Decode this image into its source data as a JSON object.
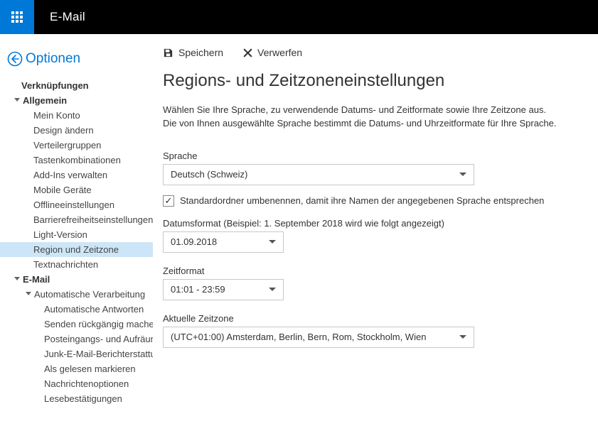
{
  "header": {
    "app_title": "E-Mail"
  },
  "sidebar": {
    "back_label": "Optionen",
    "shortcuts_label": "Verknüpfungen",
    "groups": [
      {
        "label": "Allgemein",
        "items": [
          "Mein Konto",
          "Design ändern",
          "Verteilergruppen",
          "Tastenkombinationen",
          "Add-Ins verwalten",
          "Mobile Geräte",
          "Offlineeinstellungen",
          "Barrierefreiheitseinstellungen",
          "Light-Version",
          "Region und Zeitzone",
          "Textnachrichten"
        ]
      },
      {
        "label": "E-Mail",
        "subgroups": [
          {
            "label": "Automatische Verarbeitung",
            "items": [
              "Automatische Antworten",
              "Senden rückgängig machen",
              "Posteingangs- und Aufräumregeln",
              "Junk-E-Mail-Berichterstattung",
              "Als gelesen markieren",
              "Nachrichtenoptionen",
              "Lesebestätigungen"
            ]
          }
        ]
      }
    ]
  },
  "commands": {
    "save": "Speichern",
    "discard": "Verwerfen"
  },
  "page": {
    "title": "Regions- und Zeitzoneneinstellungen",
    "desc1": "Wählen Sie Ihre Sprache, zu verwendende Datums- und Zeitformate sowie Ihre Zeitzone aus.",
    "desc2": "Die von Ihnen ausgewählte Sprache bestimmt die Datums- und Uhrzeitformate für Ihre Sprache.",
    "language_label": "Sprache",
    "language_value": "Deutsch (Schweiz)",
    "rename_checkbox": "Standardordner umbenennen, damit ihre Namen der angegebenen Sprache entsprechen",
    "dateformat_label": "Datumsformat (Beispiel: 1. September 2018 wird wie folgt angezeigt)",
    "dateformat_value": "01.09.2018",
    "timeformat_label": "Zeitformat",
    "timeformat_value": "01:01 - 23:59",
    "timezone_label": "Aktuelle Zeitzone",
    "timezone_value": "(UTC+01:00) Amsterdam, Berlin, Bern, Rom, Stockholm, Wien"
  }
}
